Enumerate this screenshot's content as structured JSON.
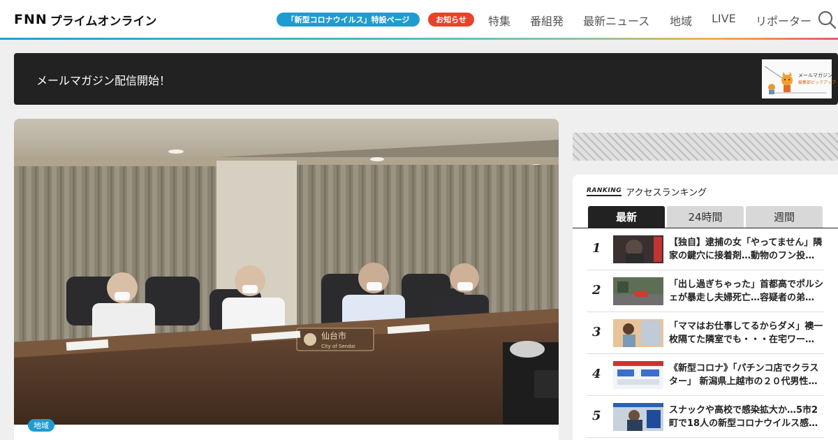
{
  "header": {
    "logo_fnn": "FNN",
    "logo_jp": "プライムオンライン",
    "corona_pill": "「新型コロナウイルス」特設ページ",
    "news_pill": "お知らせ",
    "nav": [
      "特集",
      "番組発",
      "最新ニュース",
      "地域",
      "LIVE",
      "リポーター"
    ]
  },
  "banner": {
    "text": "メールマガジン配信開始！",
    "thumb_line1": "メールマガジン",
    "thumb_line2": "編集部ピックアップ"
  },
  "article": {
    "badge": "地域",
    "nameplate_jp": "仙台市",
    "nameplate_en": "City of Sendai"
  },
  "ranking": {
    "logo": "RANKING",
    "title": "アクセスランキング",
    "tabs": [
      "最新",
      "24時間",
      "週間"
    ],
    "items": [
      {
        "rank": "1",
        "title": "【独自】逮捕の女「やってません」隣家の鍵穴に接着剤…動物のフン投…"
      },
      {
        "rank": "2",
        "title": "「出し過ぎちゃった」首都高でポルシェが暴走し夫婦死亡…容疑者の弟…"
      },
      {
        "rank": "3",
        "title": "「ママはお仕事してるからダメ」襖一枚隔てた隣室でも・・・在宅ワー…"
      },
      {
        "rank": "4",
        "title": "《新型コロナ》「パチンコ店でクラスター」 新潟県上越市の２０代男性…"
      },
      {
        "rank": "5",
        "title": "スナックや高校で感染拡大か…5市2町で18人の新型コロナウイルス感…"
      }
    ]
  },
  "colors": {
    "accent_blue": "#1f9ccf",
    "news_red": "#e8432a",
    "banner_dark": "#222222"
  }
}
